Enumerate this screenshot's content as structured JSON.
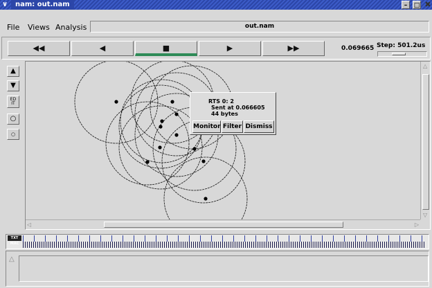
{
  "window": {
    "menu_glyph": "∨",
    "title": "nam: out.nam",
    "minimize": "–",
    "maximize": "□",
    "close": "✖"
  },
  "menu": {
    "file": "File",
    "views": "Views",
    "analysis": "Analysis",
    "filename": "out.nam"
  },
  "controls": {
    "rewind": "◀◀",
    "back": "◀",
    "stop": "■",
    "play": "▶",
    "fast_forward": "▶▶",
    "time": "0.069665",
    "step_label": "Step: 501.2us",
    "step_level": 0.4
  },
  "tools": {
    "zoom_in": "▲",
    "zoom_out": "▼",
    "edit": "ED\nIT",
    "node_shape": "○",
    "node_small": "○"
  },
  "popup": {
    "line1": "RTS 0: 2",
    "line2": "Sent at 0.066605",
    "line3": "44 bytes",
    "monitor": "Monitor",
    "filter": "Filter",
    "dismiss": "Dismiss"
  },
  "timeline": {
    "label": "TXT MAC"
  },
  "colors": {
    "titlebar": "#2c46a8",
    "play_indicator": "#2e8b57",
    "background": "#d8d8d8"
  }
}
